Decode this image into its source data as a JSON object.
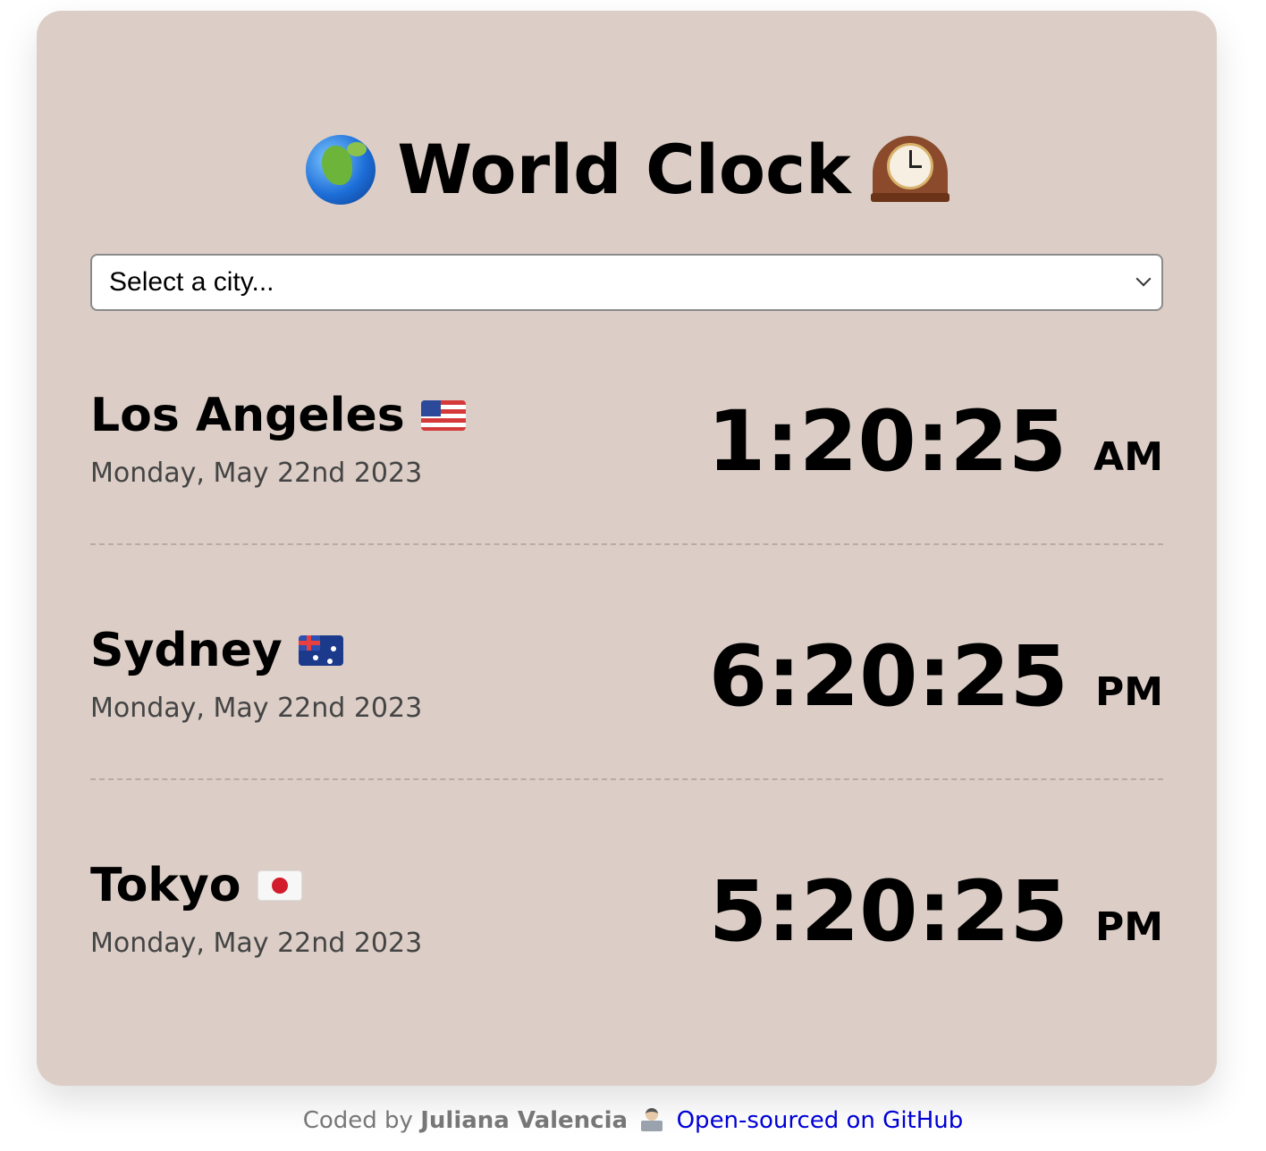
{
  "app": {
    "title": "World Clock"
  },
  "icons": {
    "title_left": "globe-africa-icon",
    "title_right": "mantelpiece-clock-icon"
  },
  "city_select": {
    "selected": "Select a city..."
  },
  "cities": [
    {
      "name": "Los Angeles",
      "flag": "us-flag-icon",
      "date": "Monday, May 22nd 2023",
      "time": "1:20:25",
      "ampm": "AM"
    },
    {
      "name": "Sydney",
      "flag": "australia-flag-icon",
      "date": "Monday, May 22nd 2023",
      "time": "6:20:25",
      "ampm": "PM"
    },
    {
      "name": "Tokyo",
      "flag": "japan-flag-icon",
      "date": "Monday, May 22nd 2023",
      "time": "5:20:25",
      "ampm": "PM"
    }
  ],
  "footer": {
    "prefix": "Coded by",
    "author": "Juliana Valencia",
    "author_icon": "technologist-icon",
    "link_text": "Open-sourced on GitHub"
  },
  "colors": {
    "card_background": "#dccec6",
    "link": "#0000d8"
  }
}
